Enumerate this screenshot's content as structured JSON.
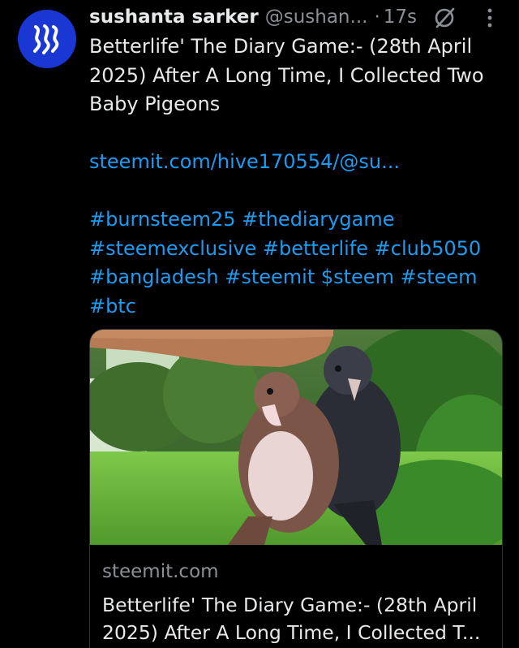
{
  "author": {
    "display_name": "sushanta sarker",
    "handle": "@sushan...",
    "separator": "·",
    "time": "17s",
    "avatar_icon": "steem-logo-icon",
    "avatar_color": "#1a37d4"
  },
  "tweet": {
    "text_lines": [
      "Betterlife' The Diary Game:- (28th April",
      "2025) After A Long Time, I Collected Two",
      "Baby Pigeons"
    ],
    "link": "steemit.com/hive170554/@su...",
    "hashtag_lines": [
      "#burnsteem25 #thediarygame",
      "#steemexclusive #betterlife #club5050",
      "#bangladesh #steemit $steem #steem",
      "#btc"
    ]
  },
  "icons": {
    "grok": "grok-icon",
    "more": "more-vertical-icon"
  },
  "card": {
    "domain": "steemit.com",
    "title_lines": [
      "Betterlife' The Diary Game:- (28th April",
      "2025) After A Long Time, I Collected T..."
    ]
  },
  "colors": {
    "background": "#000000",
    "text": "#e7e9ea",
    "muted": "#8b9096",
    "link": "#1d9bf0",
    "border": "#2f3336"
  }
}
